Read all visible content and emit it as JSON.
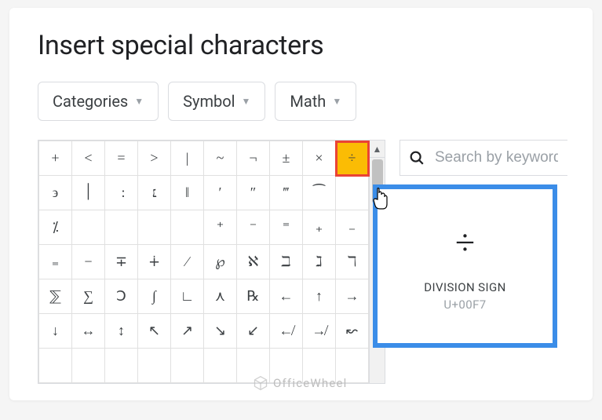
{
  "title": "Insert special characters",
  "filters": {
    "categories": "Categories",
    "symbol": "Symbol",
    "math": "Math"
  },
  "search": {
    "placeholder": "Search by keyword"
  },
  "grid": {
    "rows": [
      [
        "+",
        "<",
        "=",
        ">",
        "|",
        "~",
        "¬",
        "±",
        "×",
        "÷"
      ],
      [
        "϶",
        "׀",
        "׃",
        "׆",
        "‖",
        "′",
        "″",
        "‴",
        "⁀",
        ""
      ],
      [
        "⁒",
        "",
        "",
        "",
        "",
        "⁺",
        "⁻",
        "⁼",
        "₊",
        "₋"
      ],
      [
        "₌",
        "−",
        "∓",
        "∔",
        "∕",
        "℘",
        "ℵ",
        "ℶ",
        "ℷ",
        "ℸ"
      ],
      [
        "⅀",
        "∑",
        "Ↄ",
        "∫",
        "∟",
        "⋏",
        "℞",
        "←",
        "↑",
        "→"
      ],
      [
        "↓",
        "↔",
        "↕",
        "↖",
        "↗",
        "↘",
        "↙",
        "↚",
        "↛",
        "↜"
      ],
      [
        "",
        "",
        "",
        "",
        "",
        "",
        "",
        "",
        "",
        ""
      ]
    ],
    "selected": {
      "row": 0,
      "col": 9
    }
  },
  "preview": {
    "glyph": "÷",
    "name": "DIVISION SIGN",
    "code": "U+00F7"
  },
  "watermark": "OfficeWheel"
}
